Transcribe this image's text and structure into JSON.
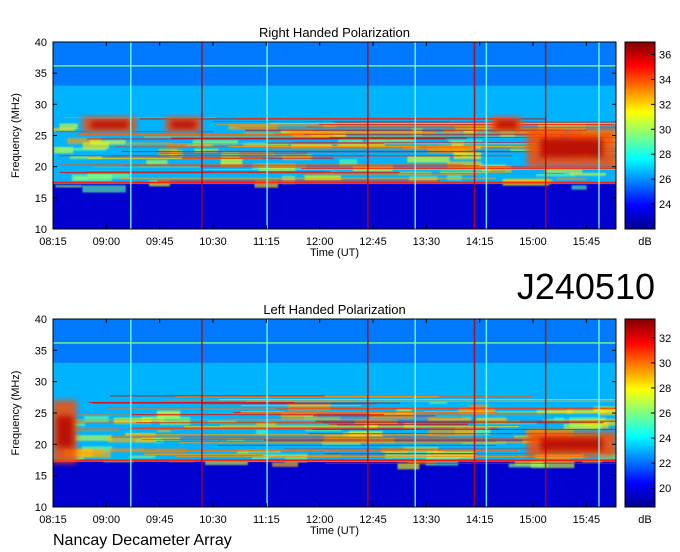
{
  "figure": {
    "date_code": "J240510",
    "footer": "Nancay Decameter Array"
  },
  "chart_data": [
    {
      "type": "heatmap",
      "title": "Right Handed Polarization",
      "xlabel": "Time (UT)",
      "ylabel": "Frequency (MHz)",
      "x_ticks": [
        "08:15",
        "09:00",
        "09:45",
        "10:30",
        "11:15",
        "12:00",
        "12:45",
        "13:30",
        "14:15",
        "15:00",
        "15:45"
      ],
      "y_ticks": [
        10,
        15,
        20,
        25,
        30,
        35,
        40
      ],
      "xlim": [
        "08:15",
        "16:10"
      ],
      "ylim": [
        10,
        40
      ],
      "colorbar": {
        "label": "dB",
        "ticks": [
          24,
          26,
          28,
          30,
          32,
          34,
          36
        ],
        "range": [
          22,
          37
        ],
        "colormap": "jet"
      },
      "features": {
        "emission_band_mhz": [
          17,
          27
        ],
        "high_intensity_regions": [
          {
            "start": "08:40",
            "end": "09:25",
            "freq": [
              25.5,
              28
            ]
          },
          {
            "start": "09:50",
            "end": "10:20",
            "freq": [
              25.5,
              28
            ]
          },
          {
            "start": "14:25",
            "end": "14:50",
            "freq": [
              25.5,
              28
            ]
          },
          {
            "start": "14:55",
            "end": "16:10",
            "freq": [
              20,
              26
            ]
          }
        ],
        "vertical_lines": [
          "09:20",
          "10:20",
          "11:15",
          "12:40",
          "13:20",
          "14:10",
          "14:20",
          "15:10",
          "15:55"
        ]
      }
    },
    {
      "type": "heatmap",
      "title": "Left Handed Polarization",
      "xlabel": "Time (UT)",
      "ylabel": "Frequency (MHz)",
      "x_ticks": [
        "08:15",
        "09:00",
        "09:45",
        "10:30",
        "11:15",
        "12:00",
        "12:45",
        "13:30",
        "14:15",
        "15:00",
        "15:45"
      ],
      "y_ticks": [
        10,
        15,
        20,
        25,
        30,
        35,
        40
      ],
      "xlim": [
        "08:15",
        "16:10"
      ],
      "ylim": [
        10,
        40
      ],
      "colorbar": {
        "label": "dB",
        "ticks": [
          20,
          22,
          24,
          26,
          28,
          30,
          32
        ],
        "range": [
          18.5,
          33.5
        ],
        "colormap": "jet"
      },
      "features": {
        "emission_band_mhz": [
          17,
          27
        ],
        "high_intensity_regions": [
          {
            "start": "08:15",
            "end": "08:35",
            "freq": [
              17,
              27
            ]
          },
          {
            "start": "14:55",
            "end": "16:10",
            "freq": [
              18,
              22
            ]
          }
        ],
        "vertical_lines": [
          "09:20",
          "10:20",
          "11:15",
          "12:40",
          "13:20",
          "14:10",
          "14:20",
          "15:10",
          "15:55"
        ]
      }
    }
  ]
}
